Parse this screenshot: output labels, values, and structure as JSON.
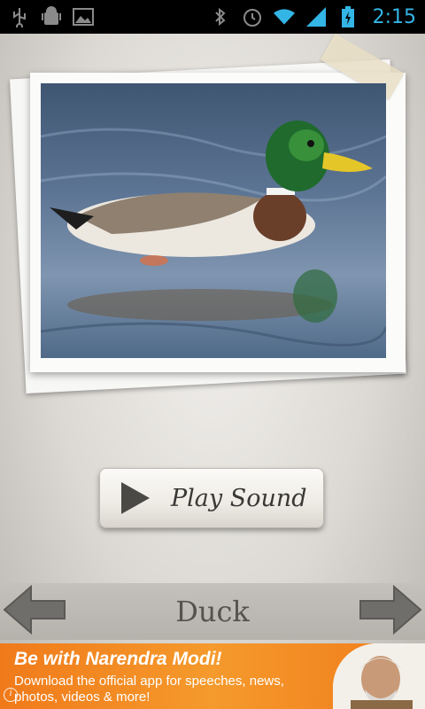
{
  "status_bar": {
    "time": "2:15",
    "icons": [
      "usb-icon",
      "android-debug-icon",
      "gallery-icon",
      "bluetooth-icon",
      "alarm-icon",
      "wifi-icon",
      "signal-icon",
      "battery-charging-icon"
    ]
  },
  "animal": {
    "name": "Duck",
    "image_icon": "mallard-duck-photo"
  },
  "play_button": {
    "label": "Play Sound",
    "icon": "play-icon"
  },
  "navigation": {
    "previous_icon": "arrow-left-icon",
    "next_icon": "arrow-right-icon"
  },
  "ad": {
    "title": "Be with Narendra Modi!",
    "body": "Download the official app for  speeches, news, photos, videos & more!",
    "info_icon": "i"
  },
  "colors": {
    "status_accent": "#33b5e5",
    "ad_orange": "#f07a1a"
  }
}
